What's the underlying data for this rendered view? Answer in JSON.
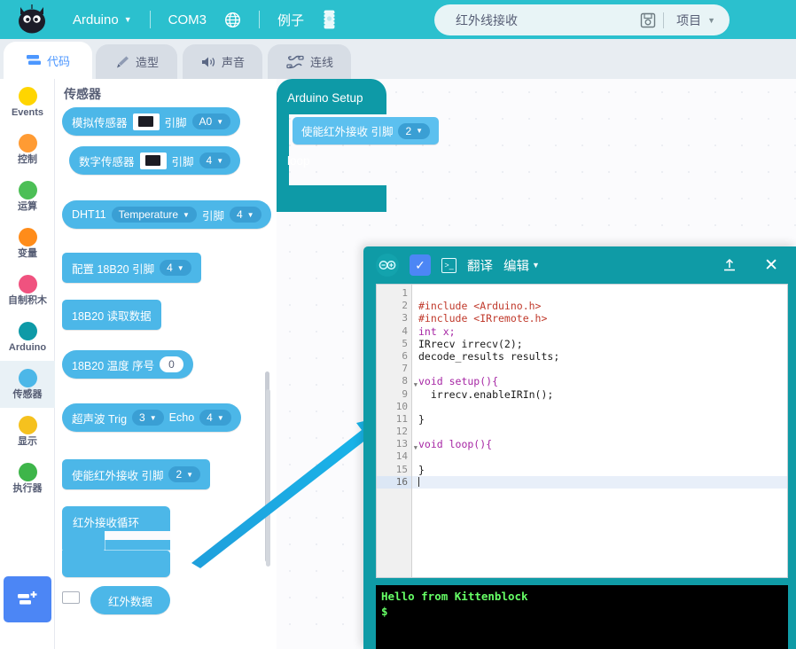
{
  "topbar": {
    "logo_icon": "kitten-cat-logo",
    "board_menu": "Arduino",
    "port": "COM3",
    "globe_icon": "globe-icon",
    "examples": "例子",
    "chip_icon": "microcontroller-chip-icon",
    "project": {
      "name": "红外线接收",
      "save_icon": "save-floppy-icon",
      "menu_label": "项目"
    },
    "accent": "#2bc0ce"
  },
  "tabs": [
    {
      "label": "代码",
      "icon": "code-blocks-icon",
      "active": true
    },
    {
      "label": "造型",
      "icon": "paintbrush-icon",
      "active": false
    },
    {
      "label": "声音",
      "icon": "speaker-icon",
      "active": false
    },
    {
      "label": "连线",
      "icon": "wiring-icon",
      "active": false
    }
  ],
  "toolbar_buttons": [
    {
      "name": "undo-button",
      "icon": "undo-arc-icon"
    },
    {
      "name": "redo-button",
      "icon": "redo-arc-icon"
    },
    {
      "name": "help-button",
      "icon": "question-mark-icon",
      "label": "?"
    }
  ],
  "sidebar": {
    "categories": [
      {
        "label": "Events",
        "color": "#ffd500",
        "selected": false
      },
      {
        "label": "控制",
        "color": "#ff9b33",
        "selected": false
      },
      {
        "label": "运算",
        "color": "#4cbf56",
        "selected": false
      },
      {
        "label": "变量",
        "color": "#ff8c1a",
        "selected": false
      },
      {
        "label": "自制积木",
        "color": "#f0527f",
        "selected": false
      },
      {
        "label": "Arduino",
        "color": "#0e9aa7",
        "selected": false
      },
      {
        "label": "传感器",
        "color": "#4cb7e8",
        "selected": true
      },
      {
        "label": "显示",
        "color": "#f5c11e",
        "selected": false
      },
      {
        "label": "执行器",
        "color": "#3eb54a",
        "selected": false
      }
    ],
    "add_extension": {
      "name": "add-extension-button",
      "icon": "add-extension-icon"
    }
  },
  "palette": {
    "title": "传感器",
    "blocks": [
      {
        "id": "analog-sensor",
        "prefix": "模拟传感器",
        "image": "sensor-photo",
        "mid": "引脚",
        "value": "A0",
        "dropdown": true
      },
      {
        "id": "digital-sensor",
        "prefix": "数字传感器",
        "image": "sensor-photo",
        "mid": "引脚",
        "value": "4",
        "dropdown": true
      },
      {
        "id": "dht11",
        "prefix": "DHT11",
        "select": "Temperature",
        "mid": "引脚",
        "value": "4",
        "dropdown": true
      },
      {
        "id": "config-18b20",
        "prefix": "配置 18B20 引脚",
        "value": "4",
        "dropdown": true
      },
      {
        "id": "read-18b20",
        "prefix": "18B20 读取数据"
      },
      {
        "id": "temp-18b20",
        "prefix": "18B20 温度 序号",
        "value": "0",
        "dropdown": false
      },
      {
        "id": "ultrasonic",
        "prefix": "超声波 Trig",
        "value": "3",
        "mid": "Echo",
        "value2": "4",
        "dropdown": true
      },
      {
        "id": "enable-ir",
        "prefix": "使能红外接收 引脚",
        "value": "2",
        "dropdown": true
      },
      {
        "id": "ir-loop",
        "prefix": "红外接收循环"
      },
      {
        "id": "ir-data",
        "prefix": "红外数据"
      }
    ]
  },
  "canvas": {
    "hat_block": {
      "setup_label": "Arduino Setup",
      "loop_label": "loop",
      "color": "#0e9aa7"
    },
    "inner_block": {
      "label": "使能红外接收 引脚",
      "value": "2",
      "dropdown": true
    },
    "annotation_arrow": {
      "name": "pointer-arrow",
      "color": "#1ba8e0"
    }
  },
  "code_window": {
    "arduino_icon": "arduino-infinity-icon",
    "verify_icon": "checkmark-icon",
    "terminal_icon": "terminal-icon",
    "translate_label": "翻译",
    "edit_label": "编辑",
    "upload_icon": "upload-icon",
    "close_icon": "close-x-icon",
    "lines": [
      {
        "n": 1,
        "text": "",
        "fold": false
      },
      {
        "n": 2,
        "text": "#include <Arduino.h>",
        "kind": "pre"
      },
      {
        "n": 3,
        "text": "#include <IRremote.h>",
        "kind": "pre"
      },
      {
        "n": 4,
        "text": "int x;",
        "kind": "kw1"
      },
      {
        "n": 5,
        "text": "IRrecv irrecv(2);",
        "kind": "plain"
      },
      {
        "n": 6,
        "text": "decode_results results;",
        "kind": "plain"
      },
      {
        "n": 7,
        "text": "",
        "kind": "plain"
      },
      {
        "n": 8,
        "text": "void setup(){",
        "kind": "kw1",
        "fold": true
      },
      {
        "n": 9,
        "text": "  irrecv.enableIRIn();",
        "kind": "plain"
      },
      {
        "n": 10,
        "text": "",
        "kind": "plain"
      },
      {
        "n": 11,
        "text": "}",
        "kind": "plain"
      },
      {
        "n": 12,
        "text": "",
        "kind": "plain"
      },
      {
        "n": 13,
        "text": "void loop(){",
        "kind": "kw1",
        "fold": true
      },
      {
        "n": 14,
        "text": "",
        "kind": "plain"
      },
      {
        "n": 15,
        "text": "}",
        "kind": "plain"
      },
      {
        "n": 16,
        "text": "",
        "kind": "plain",
        "highlight": true
      }
    ]
  },
  "terminal": {
    "output": "Hello from Kittenblock",
    "prompt": "$",
    "text_color": "#66ff66"
  }
}
